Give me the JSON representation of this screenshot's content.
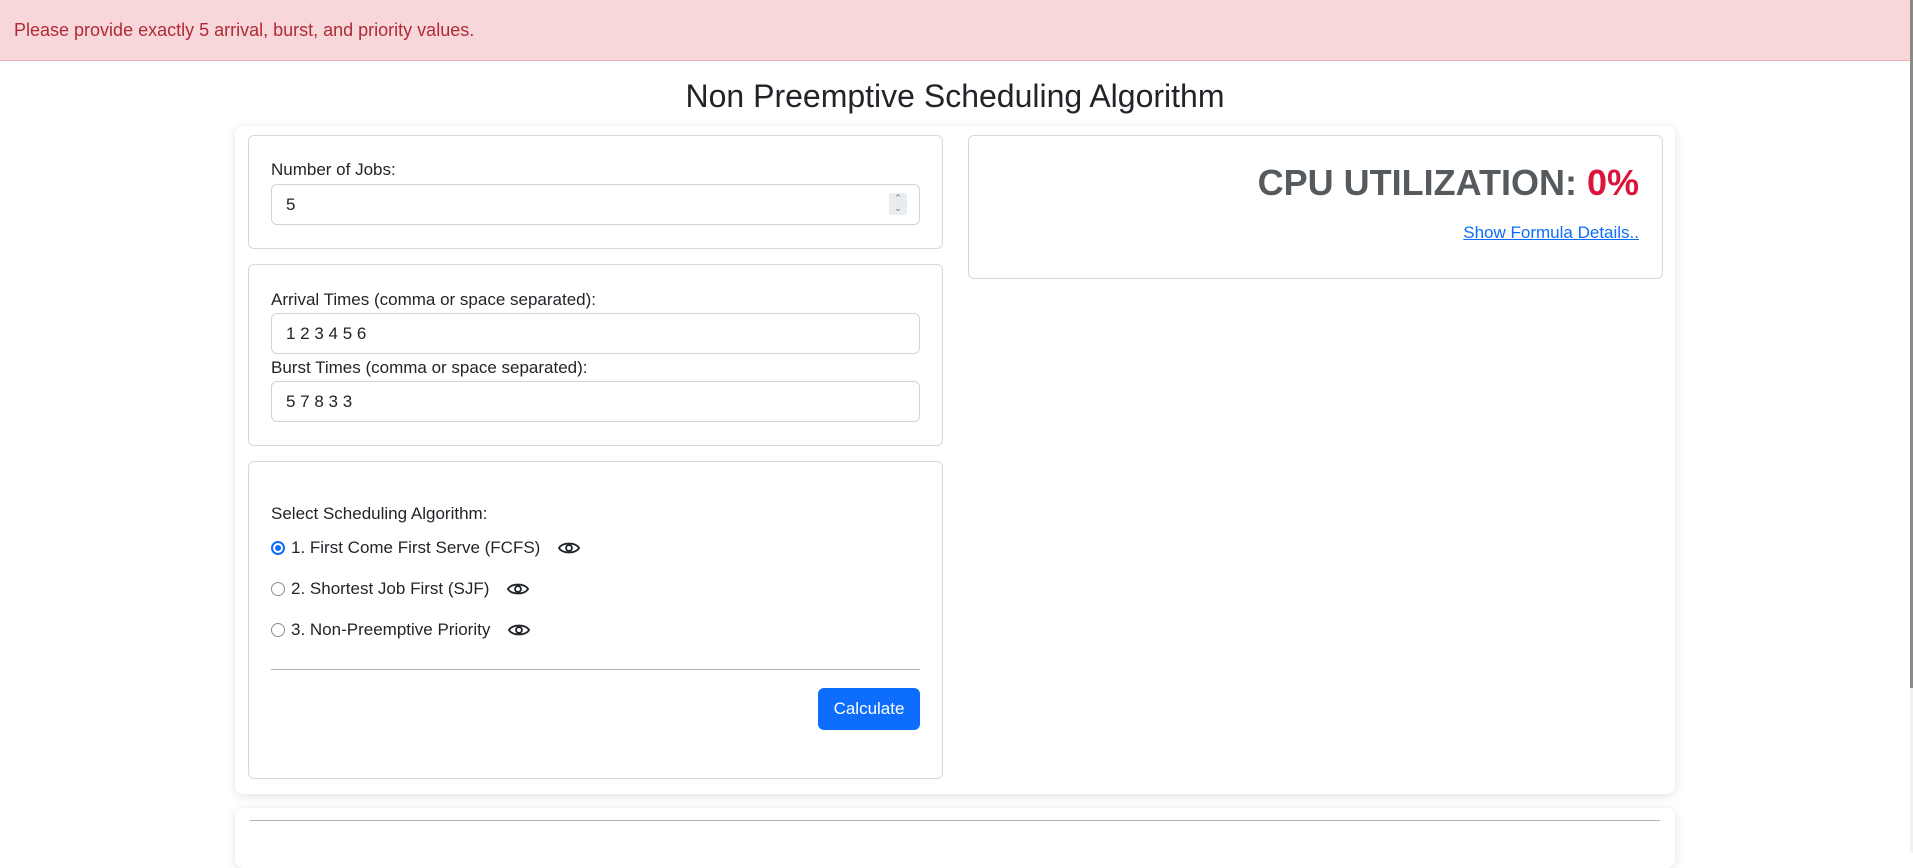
{
  "alert": {
    "message": "Please provide exactly 5 arrival, burst, and priority values."
  },
  "page": {
    "title": "Non Preemptive Scheduling Algorithm"
  },
  "jobs": {
    "label": "Number of Jobs:",
    "value": "5"
  },
  "times": {
    "arrival_label": "Arrival Times (comma or space separated):",
    "arrival_value": "1 2 3 4 5 6",
    "burst_label": "Burst Times (comma or space separated):",
    "burst_value": "5 7 8 3 3"
  },
  "algorithm": {
    "label": "Select Scheduling Algorithm:",
    "selected": "fcfs",
    "options": [
      {
        "id": "fcfs",
        "label": "1. First Come First Serve (FCFS)",
        "icon": "eye-icon"
      },
      {
        "id": "sjf",
        "label": "2. Shortest Job First (SJF)",
        "icon": "eye-icon"
      },
      {
        "id": "priority",
        "label": "3. Non-Preemptive Priority",
        "icon": "eye-icon"
      }
    ],
    "calculate_label": "Calculate"
  },
  "cpu": {
    "label": "CPU UTILIZATION: ",
    "value": "0%",
    "formula_link": "Show Formula Details.."
  },
  "colors": {
    "alert_bg": "#f8d7da",
    "alert_text": "#b02a37",
    "primary": "#0d6efd",
    "cpu_value": "#dc143c"
  }
}
